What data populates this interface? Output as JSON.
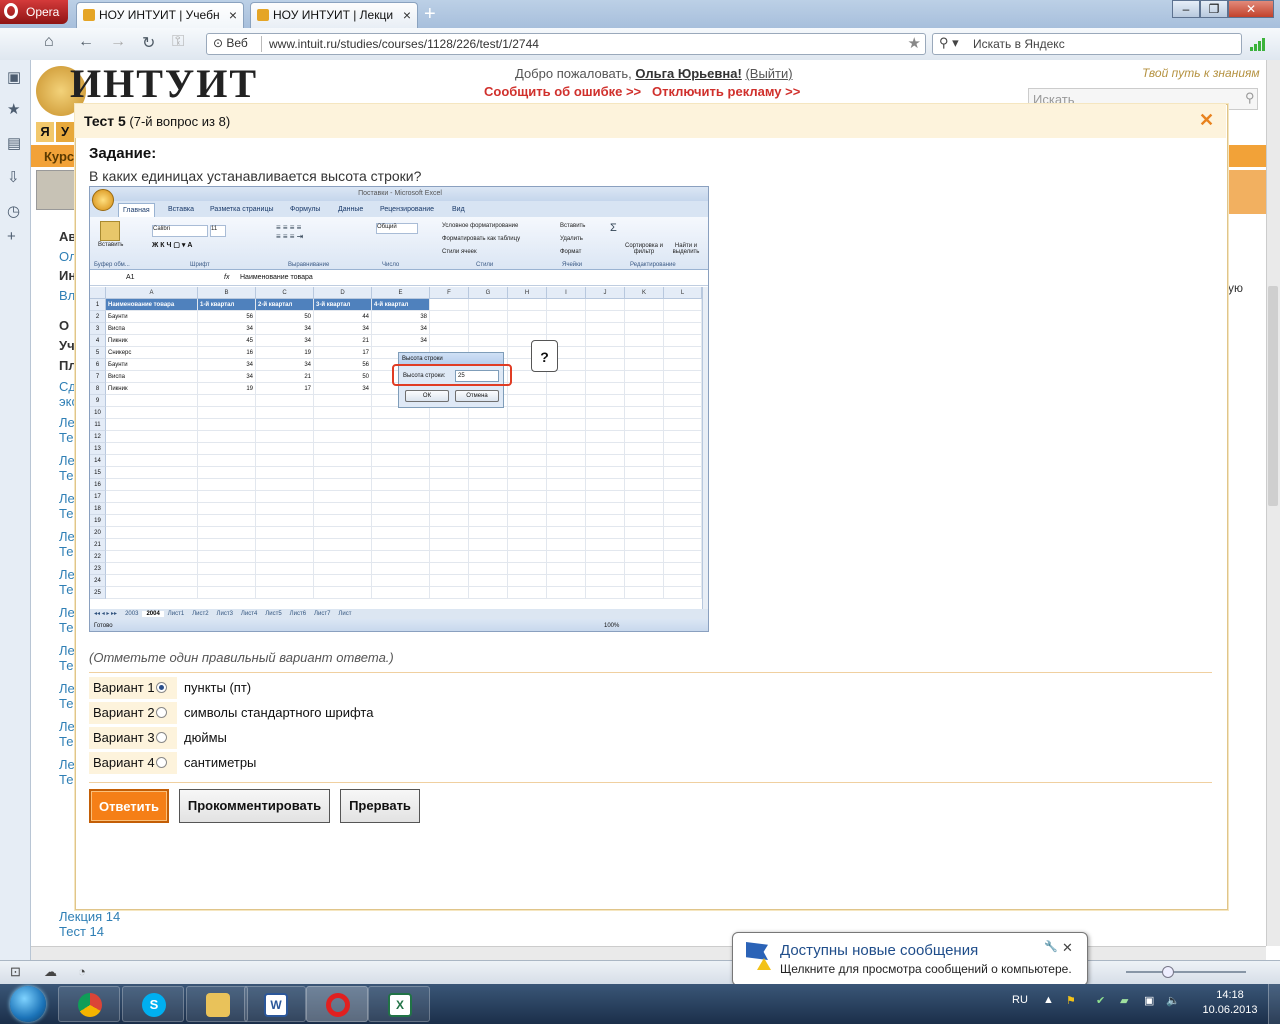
{
  "browser": {
    "menu_label": "Opera",
    "tabs": [
      {
        "title": "НОУ ИНТУИТ | Учебн..."
      },
      {
        "title": "НОУ ИНТУИТ | Лекци..."
      }
    ],
    "address_prefix": "Веб",
    "url": "www.intuit.ru/studies/courses/1128/226/test/1/2744",
    "search_placeholder": "Искать в Яндекс"
  },
  "site": {
    "logo_text": "ИНТУИТ",
    "welcome": "Добро пожаловать,",
    "user_name": "Ольга Юрьевна!",
    "logout": "(Выйти)",
    "report_error": "Сообщить об ошибке >>",
    "disable_ads": "Отключить рекламу >>",
    "slogan": "Твой путь к знаниям",
    "search_placeholder": "Искать",
    "side_fragments": [
      "Я",
      "У",
      "Курс",
      "Ав",
      "Ол",
      "Ин",
      "Вл",
      "О",
      "Уч",
      "Пл",
      "Сд",
      "экс",
      "Ле",
      "Те",
      "Ле",
      "Те",
      "Ле",
      "Те",
      "Ле",
      "Те",
      "Ле",
      "Те",
      "Ле",
      "Те",
      "Ле",
      "Те",
      "Ле",
      "Те",
      "Ле",
      "Те",
      "Ле",
      "Те"
    ],
    "lecture14": "Лекция 14",
    "test14": "Тест 14",
    "right_fragment": "ую"
  },
  "dialog": {
    "title_bold": "Тест 5",
    "title_rest": "(7-й вопрос из 8)",
    "task_heading": "Задание:",
    "question": "В каких единицах устанавливается высота строки?",
    "hint": "(Отметьте один правильный вариант ответа.)",
    "options": [
      {
        "label": "Вариант 1",
        "text": "пункты (пт)",
        "selected": true
      },
      {
        "label": "Вариант 2",
        "text": "символы стандартного шрифта",
        "selected": false
      },
      {
        "label": "Вариант 3",
        "text": "дюймы",
        "selected": false
      },
      {
        "label": "Вариант 4",
        "text": "сантиметры",
        "selected": false
      }
    ],
    "btn_answer": "Ответить",
    "btn_comment": "Прокомментировать",
    "btn_abort": "Прервать"
  },
  "excel": {
    "window_title": "Поставки - Microsoft Excel",
    "ribbon_tabs": [
      "Главная",
      "Вставка",
      "Разметка страницы",
      "Формулы",
      "Данные",
      "Рецензирование",
      "Вид"
    ],
    "ribbon_groups": [
      "Буфер обм...",
      "Шрифт",
      "Выравнивание",
      "Число",
      "Стили",
      "Ячейки",
      "Редактирование"
    ],
    "ribbon_texts": {
      "paste": "Вставить",
      "font": "Calibri",
      "size": "11",
      "number": "Общий",
      "cond": "Условное форматирование",
      "table": "Форматировать как таблицу",
      "styles": "Стили ячеек",
      "insert": "Вставить",
      "delete": "Удалить",
      "format": "Формат",
      "sort": "Сортировка и фильтр",
      "find": "Найти и выделить"
    },
    "name_box": "A1",
    "formula": "Наименование товара",
    "columns": [
      "A",
      "B",
      "C",
      "D",
      "E",
      "F",
      "G",
      "H",
      "I",
      "J",
      "K",
      "L"
    ],
    "header_row": [
      "Наименование товара",
      "1-й квартал",
      "2-й квартал",
      "3-й квартал",
      "4-й квартал"
    ],
    "rows": [
      [
        "Баунти",
        "56",
        "50",
        "44",
        "38"
      ],
      [
        "Виспа",
        "34",
        "34",
        "34",
        "34"
      ],
      [
        "Пикник",
        "45",
        "34",
        "21",
        "34"
      ],
      [
        "Сникерс",
        "16",
        "19",
        "17",
        ""
      ],
      [
        "Баунти",
        "34",
        "34",
        "56",
        ""
      ],
      [
        "Виспа",
        "34",
        "21",
        "50",
        ""
      ],
      [
        "Пикник",
        "19",
        "17",
        "34",
        ""
      ]
    ],
    "row_count": 25,
    "sheets": [
      "2003",
      "2004",
      "Лист1",
      "Лист2",
      "Лист3",
      "Лист4",
      "Лист5",
      "Лист6",
      "Лист7",
      "Лист"
    ],
    "status_ready": "Готово",
    "zoom": "100%",
    "row_height_dialog": {
      "title": "Высота строки",
      "label": "Высота строки:",
      "value": "25",
      "ok": "ОК",
      "cancel": "Отмена"
    },
    "callout": "?"
  },
  "notification": {
    "title": "Доступны новые сообщения",
    "text": "Щелкните для просмотра сообщений о компьютере."
  },
  "taskbar": {
    "lang": "RU",
    "time": "14:18",
    "date": "10.06.2013"
  }
}
